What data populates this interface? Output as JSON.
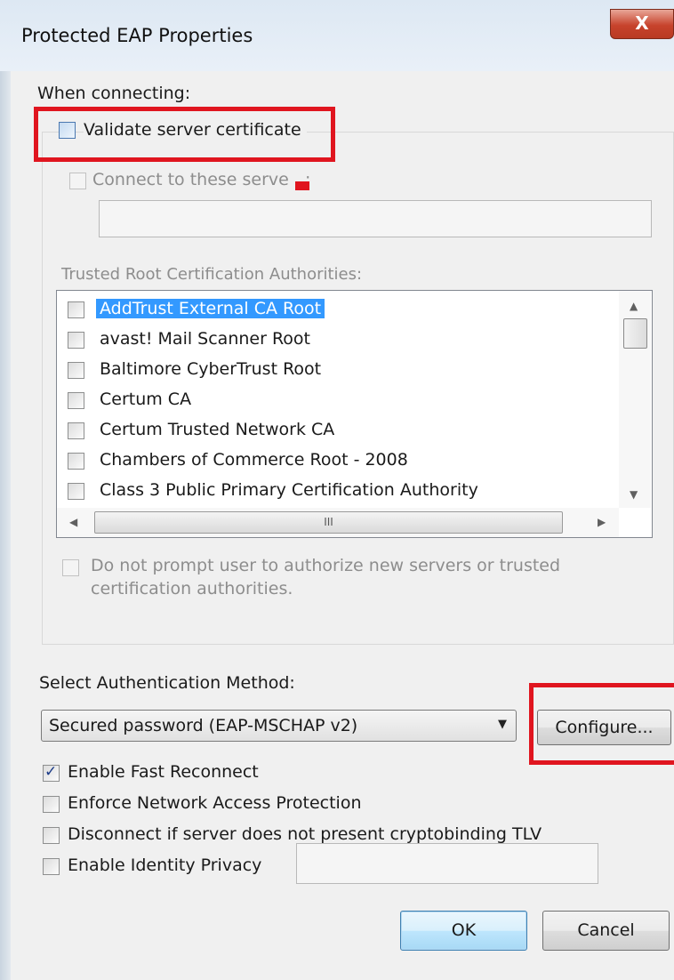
{
  "window": {
    "title": "Protected EAP Properties",
    "close_glyph": "X"
  },
  "when_connecting_label": "When connecting:",
  "validate_cert": {
    "label": "Validate server certificate",
    "checked": false
  },
  "connect_servers": {
    "label": "Connect to these serve   :",
    "value": ""
  },
  "trusted_root_label": "Trusted Root Certification Authorities:",
  "ca_list": [
    {
      "label": "AddTrust External CA Root",
      "selected": true
    },
    {
      "label": "avast! Mail Scanner Root"
    },
    {
      "label": "Baltimore CyberTrust Root"
    },
    {
      "label": "Certum CA"
    },
    {
      "label": "Certum Trusted Network CA"
    },
    {
      "label": "Chambers of Commerce Root - 2008"
    },
    {
      "label": "Class 3 Public Primary Certification Authority"
    }
  ],
  "hscroll_grip": "III",
  "do_not_prompt": {
    "line1": "Do not prompt user to authorize new servers or trusted",
    "line2": "certification authorities."
  },
  "auth_method_label": "Select Authentication Method:",
  "auth_method_value": "Secured password (EAP-MSCHAP v2)",
  "configure_label": "Configure...",
  "options": {
    "fast_reconnect": {
      "label": "Enable Fast Reconnect",
      "checked": true
    },
    "nap": {
      "label": "Enforce Network Access Protection",
      "checked": false
    },
    "cryptobinding": {
      "label": "Disconnect if server does not present cryptobinding TLV",
      "checked": false
    },
    "identity_privacy": {
      "label": "Enable Identity Privacy",
      "checked": false,
      "value": ""
    }
  },
  "buttons": {
    "ok": "OK",
    "cancel": "Cancel"
  },
  "colors": {
    "highlight": "#e0151f",
    "selection": "#3399ff"
  }
}
